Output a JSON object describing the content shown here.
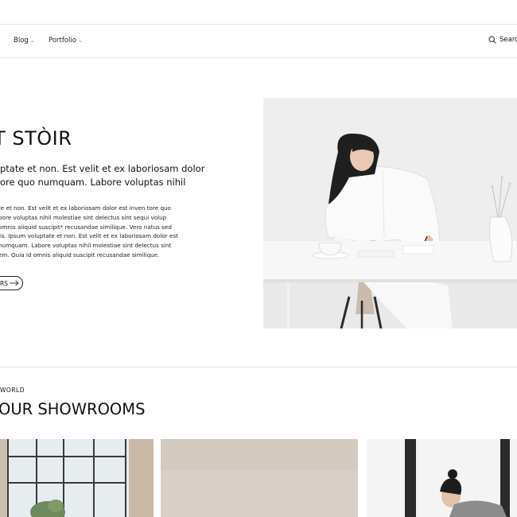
{
  "nav": {
    "items": [
      {
        "label": "Blog",
        "chevron": "⌄"
      },
      {
        "label": "Portfolio",
        "chevron": "⌄"
      }
    ],
    "search_label": "Search"
  },
  "hero": {
    "title": "UT STÒIR",
    "subtitle_lines": [
      "ptate et non. Est velit et ex laboriosam dolor",
      "ore quo numquam. Labore voluptas nihil"
    ],
    "body_lines": [
      "te et non. Est velit et ex laboriosam dolor est inven tore quo",
      "bore voluptas nihil molestiae sint delectus sint sequi volup",
      "omnis aliquid suscipit* recusandae similique. Vero natus sed",
      "lis. Ipsum voluptate et non. Est velit et ex laboriosam dolor est",
      " numquam. Labore voluptas nihil molestiae sint delectus sint",
      "em. Quia id omnis aliquid suscipit recusandae similique."
    ],
    "button_label": "RS",
    "button_icon": "arrow-right-icon"
  },
  "showrooms": {
    "kicker": "WORLD",
    "title": "OUR SHOWROOMS"
  },
  "colors": {
    "border": "#e6e6e6",
    "text": "#111111"
  }
}
